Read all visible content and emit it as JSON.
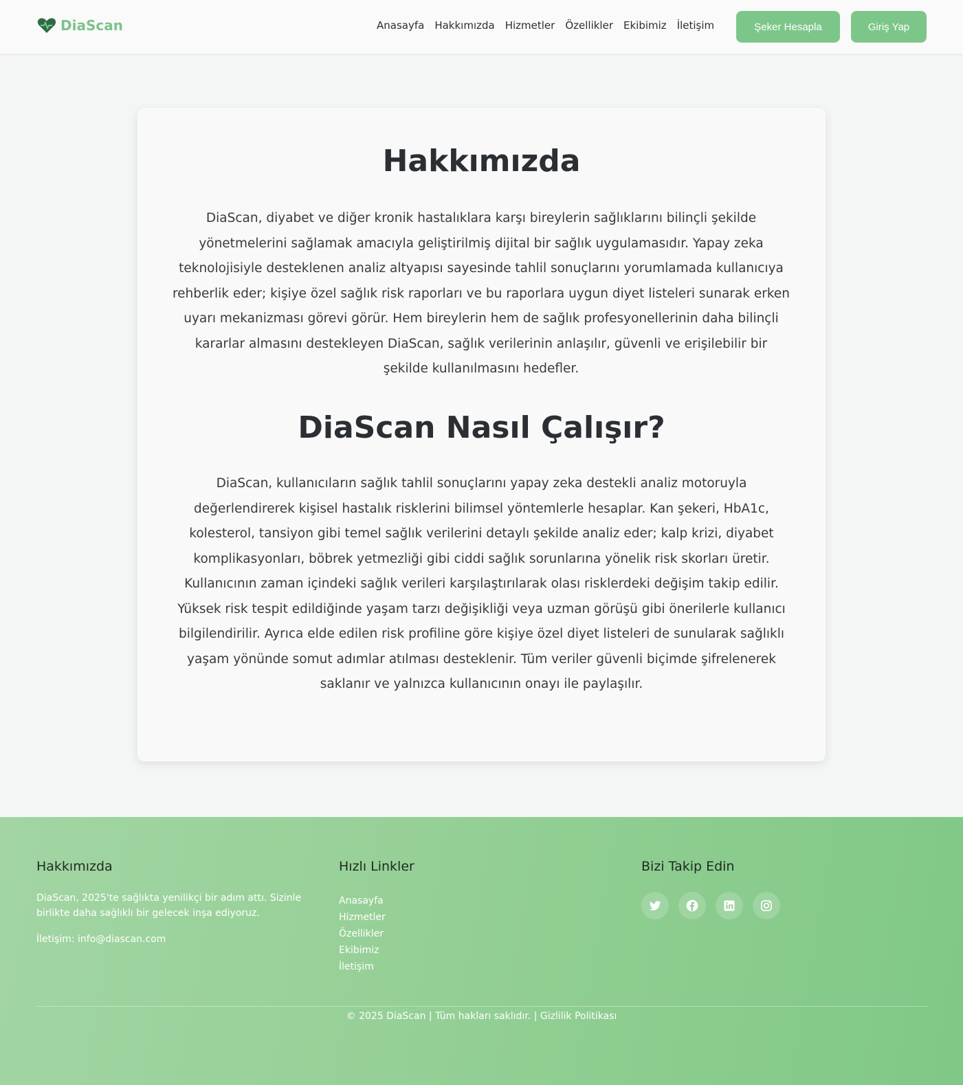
{
  "header": {
    "brand": "DiaScan",
    "nav": [
      "Anasayfa",
      "Hakkımızda",
      "Hizmetler",
      "Özellikler",
      "Ekibimiz",
      "İletişim"
    ],
    "seker_button": "Şeker Hesapla",
    "giris_button": "Giriş Yap"
  },
  "main": {
    "about_title": "Hakkımızda",
    "about_text": "DiaScan, diyabet ve diğer kronik hastalıklara karşı bireylerin sağlıklarını bilinçli şekilde yönetmelerini sağlamak amacıyla geliştirilmiş dijital bir sağlık uygulamasıdır. Yapay zeka teknolojisiyle desteklenen analiz altyapısı sayesinde tahlil sonuçlarını yorumlamada kullanıcıya rehberlik eder; kişiye özel sağlık risk raporları ve bu raporlara uygun diyet listeleri sunarak erken uyarı mekanizması görevi görür. Hem bireylerin hem de sağlık profesyonellerinin daha bilinçli kararlar almasını destekleyen DiaScan, sağlık verilerinin anlaşılır, güvenli ve erişilebilir bir şekilde kullanılmasını hedefler.",
    "how_title": "DiaScan Nasıl Çalışır?",
    "how_text": "DiaScan, kullanıcıların sağlık tahlil sonuçlarını yapay zeka destekli analiz motoruyla değerlendirerek kişisel hastalık risklerini bilimsel yöntemlerle hesaplar. Kan şekeri, HbA1c, kolesterol, tansiyon gibi temel sağlık verilerini detaylı şekilde analiz eder; kalp krizi, diyabet komplikasyonları, böbrek yetmezliği gibi ciddi sağlık sorunlarına yönelik risk skorları üretir. Kullanıcının zaman içindeki sağlık verileri karşılaştırılarak olası risklerdeki değişim takip edilir. Yüksek risk tespit edildiğinde yaşam tarzı değişikliği veya uzman görüşü gibi önerilerle kullanıcı bilgilendirilir. Ayrıca elde edilen risk profiline göre kişiye özel diyet listeleri de sunularak sağlıklı yaşam yönünde somut adımlar atılması desteklenir. Tüm veriler güvenli biçimde şifrelenerek saklanır ve yalnızca kullanıcının onayı ile paylaşılır."
  },
  "footer": {
    "about_title": "Hakkımızda",
    "about_text": "DiaScan, 2025'te sağlıkta yenilikçi bir adım attı. Sizinle birlikte daha sağlıklı bir gelecek inşa ediyoruz.",
    "contact": "İletişim: info@diascan.com",
    "links_title": "Hızlı Linkler",
    "links": [
      "Anasayfa",
      "Hizmetler",
      "Özellikler",
      "Ekibimiz",
      "İletişim"
    ],
    "follow_title": "Bizi Takip Edin",
    "socials": [
      "twitter-icon",
      "facebook-icon",
      "linkedin-icon",
      "instagram-icon"
    ],
    "copyright": "© 2025 DiaScan | Tüm hakları saklıdır. | Gizlilik Politikası"
  },
  "colors": {
    "accent": "#7dc68a",
    "logo": "#7cc389",
    "footer_start": "#a2d5a3",
    "footer_end": "#80c887"
  }
}
